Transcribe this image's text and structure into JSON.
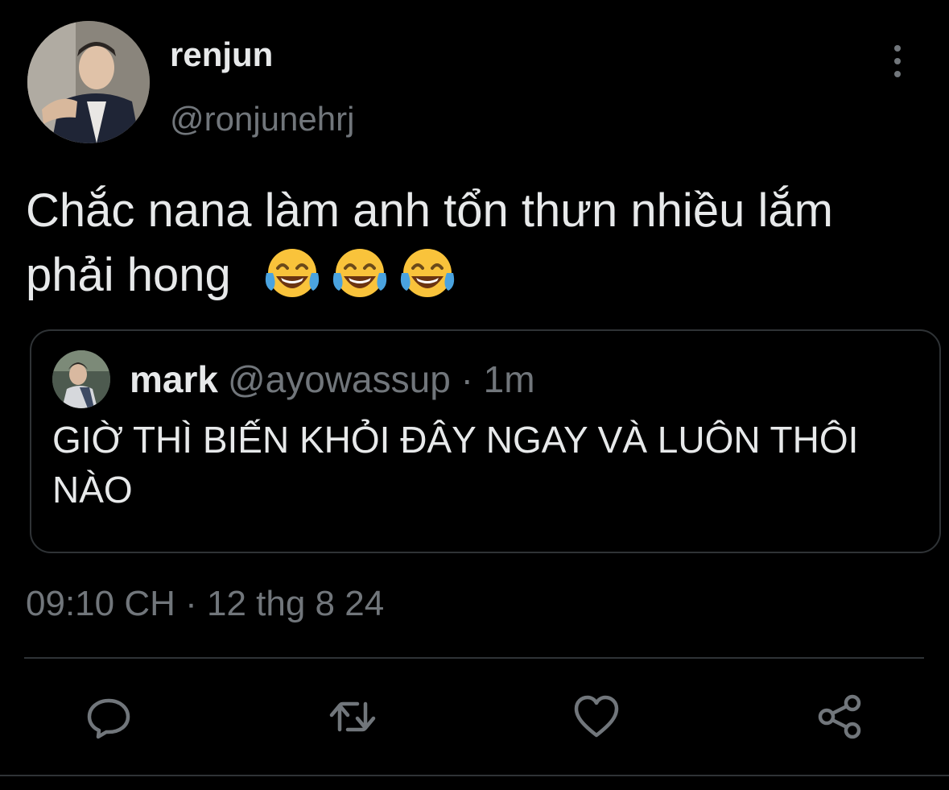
{
  "tweet": {
    "author": {
      "display_name": "renjun",
      "handle": "@ronjunehrj",
      "avatar_icon": "profile-photo-icon"
    },
    "text": "Chắc nana làm anh tổn thưn nhiều lắm phải hong",
    "emojis": [
      "face-with-tears-of-joy",
      "face-with-tears-of-joy",
      "face-with-tears-of-joy"
    ],
    "timestamp": "09:10 CH · 12 thg 8 24"
  },
  "quoted_tweet": {
    "display_name": "mark",
    "meta": "@ayowassup · 1m",
    "text": "GIỜ THÌ BIẾN KHỎI ĐÂY NGAY VÀ LUÔN THÔI NÀO",
    "avatar_icon": "profile-photo-icon"
  },
  "actions": [
    {
      "name": "reply",
      "icon": "speech-bubble-icon"
    },
    {
      "name": "retweet",
      "icon": "retweet-icon"
    },
    {
      "name": "like",
      "icon": "heart-icon"
    },
    {
      "name": "share",
      "icon": "share-icon"
    }
  ],
  "colors": {
    "background": "#000000",
    "primary_text": "#e7e9ea",
    "secondary_text": "#71767b",
    "border": "#2f3336",
    "emoji_yellow": "#f9c33b",
    "emoji_tear": "#4aa3df"
  }
}
